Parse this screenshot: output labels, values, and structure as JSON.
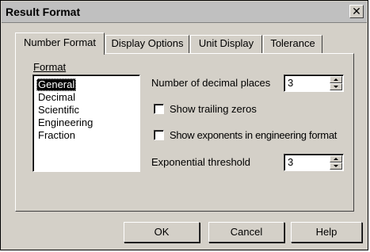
{
  "window": {
    "title": "Result Format",
    "close_glyph": "✕"
  },
  "tabs": [
    "Number Format",
    "Display Options",
    "Unit Display",
    "Tolerance"
  ],
  "format": {
    "label": "Format",
    "items": [
      "General",
      "Decimal",
      "Scientific",
      "Engineering",
      "Fraction"
    ],
    "selected": "General"
  },
  "options": {
    "decimal_places_label": "Number of decimal places",
    "decimal_places_value": "3",
    "show_trailing_zeros_label": "Show trailing zeros",
    "show_trailing_zeros_checked": false,
    "show_exponents_label": "Show exponents in engineering format",
    "show_exponents_checked": false,
    "exp_threshold_label": "Exponential threshold",
    "exp_threshold_value": "3"
  },
  "buttons": {
    "ok": "OK",
    "cancel": "Cancel",
    "help": "Help"
  }
}
